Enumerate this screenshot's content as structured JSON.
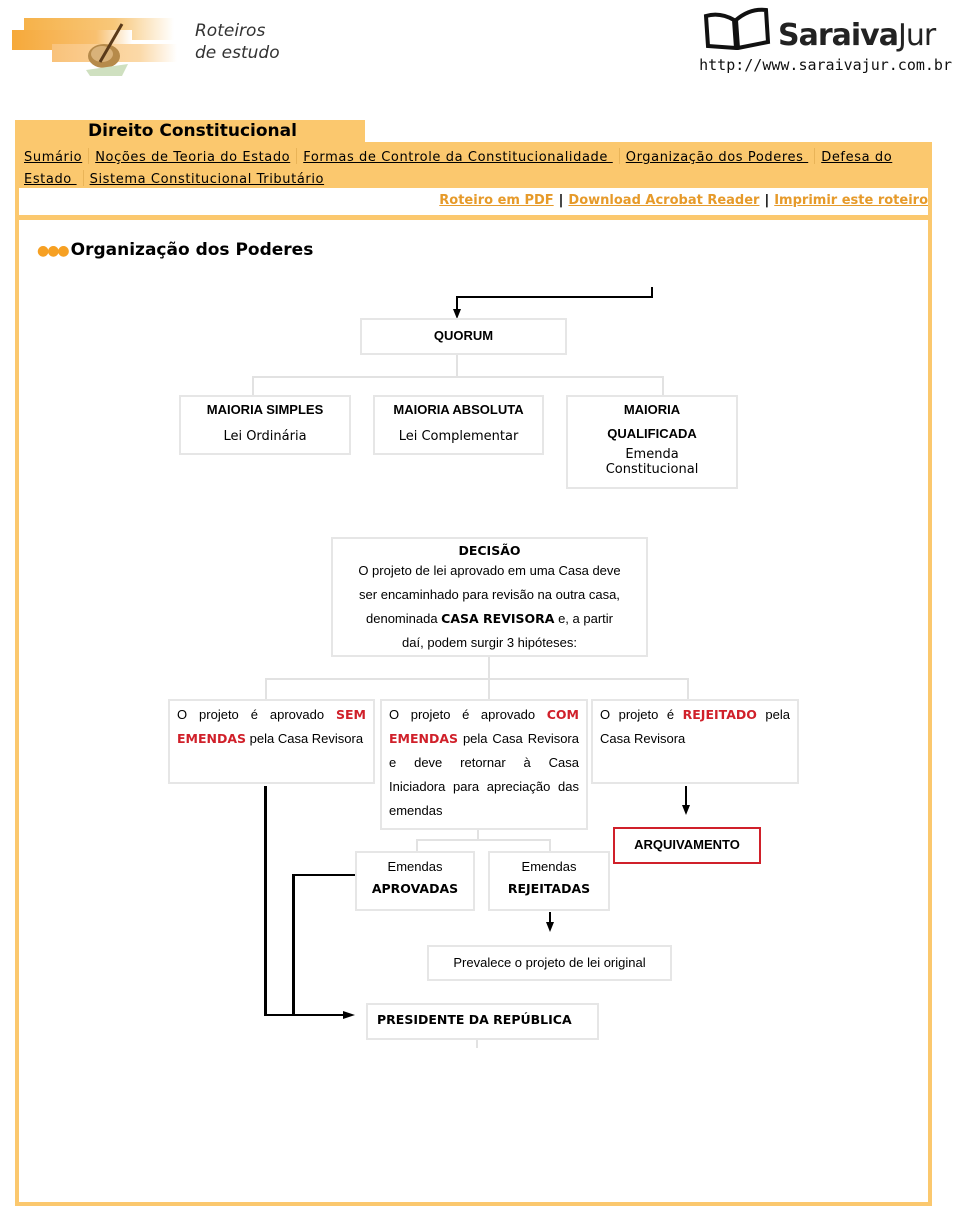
{
  "header": {
    "logo_text_line1": "Roteiros",
    "logo_text_line2": "de estudo",
    "brand_name_bold": "Saraiva",
    "brand_name_light": "Jur",
    "brand_url": "http://www.saraivajur.com.br"
  },
  "tab_title": "Direito Constitucional",
  "nav": {
    "items": [
      {
        "label": "Sumário"
      },
      {
        "label": "Noções de Teoria do Estado"
      },
      {
        "label": "Formas de Controle da Constitucionalidade "
      },
      {
        "label": "Organização dos Poderes "
      },
      {
        "label": "Defesa do "
      },
      {
        "label": "Estado "
      },
      {
        "label": "Sistema Constitucional Tributário"
      }
    ]
  },
  "toolbar": {
    "pdf_label": "Roteiro em PDF",
    "acrobat_label": "Download Acrobat Reader",
    "print_label": "Imprimir este roteiro",
    "separator": "|"
  },
  "section": {
    "bullets": "●●●",
    "title": "Organização dos Poderes"
  },
  "diagram": {
    "colors": {
      "accent": "#fbc86e",
      "red": "#d0202a",
      "link": "#e69a2a",
      "box_border": "#e6e6e6"
    },
    "quorum": "QUORUM",
    "maioria_simples": {
      "title": "MAIORIA SIMPLES",
      "sub": "Lei Ordinária"
    },
    "maioria_absoluta": {
      "title": "MAIORIA ABSOLUTA",
      "sub": "Lei Complementar"
    },
    "maioria_qualificada": {
      "title_1": "MAIORIA",
      "title_2": "QUALIFICADA",
      "sub_1": "Emenda",
      "sub_2": "Constitucional"
    },
    "decisao": {
      "title": "DECISÃO",
      "line1": "O projeto de lei aprovado em uma Casa deve",
      "line2": "ser encaminhado para revisão na outra casa,",
      "line3_pre": "denominada ",
      "line3_bold": "CASA  REVISORA",
      "line3_post": " e, a partir",
      "line4": "daí, podem surgir 3 hipóteses:"
    },
    "sem_emendas": {
      "pre": "O projeto é aprovado ",
      "red": "SEM EMENDAS",
      "post": " pela Casa Revisora"
    },
    "com_emendas": {
      "pre": "O projeto é aprovado ",
      "red": "COM EMENDAS",
      "post": " pela Casa Revisora e deve retornar à Casa Iniciadora para apreciação das emendas"
    },
    "rejeitado": {
      "pre": "O projeto é ",
      "red": "REJEITADO",
      "post": " pela Casa Revisora"
    },
    "arquivamento": "ARQUIVAMENTO",
    "aprovadas": {
      "line1": "Emendas",
      "line2": "APROVADAS"
    },
    "rejeitadas": {
      "line1": "Emendas",
      "line2": "REJEITADAS"
    },
    "prevalece": "Prevalece o projeto de lei original",
    "presidente": "PRESIDENTE DA REPÚBLICA"
  }
}
